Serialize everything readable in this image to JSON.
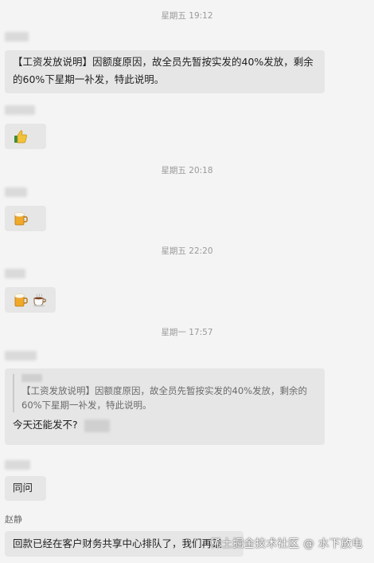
{
  "timestamps": {
    "t1": "星期五 19:12",
    "t2": "星期五 20:18",
    "t3": "星期五 22:20",
    "t4": "星期一 17:57"
  },
  "messages": {
    "m1_text": "【工资发放说明】因额度原因，故全员先暂按实发的40%发放，剩余的60%下星期一补发，特此说明。",
    "m2_emoji": "thumbs-up",
    "m3_emoji": "beer-mug",
    "m4_emojis": [
      "beer-mug",
      "coffee-cup"
    ],
    "m5_quote": "【工资发放说明】因额度原因，故全员先暂按实发的40%发放，剩余的60%下星期一补发，特此说明。",
    "m5_text": "今天还能发不?",
    "m6_text": "同问",
    "m7_sender": "赵静",
    "m7_text": "回款已经在客户财务共享中心排队了，我们再跟"
  },
  "watermark": "稀土掘金技术社区 @ 水下放电",
  "colors": {
    "background": "#f4f4f5",
    "bubble": "#e6e6e6",
    "timestamp": "#9a9a9a"
  }
}
